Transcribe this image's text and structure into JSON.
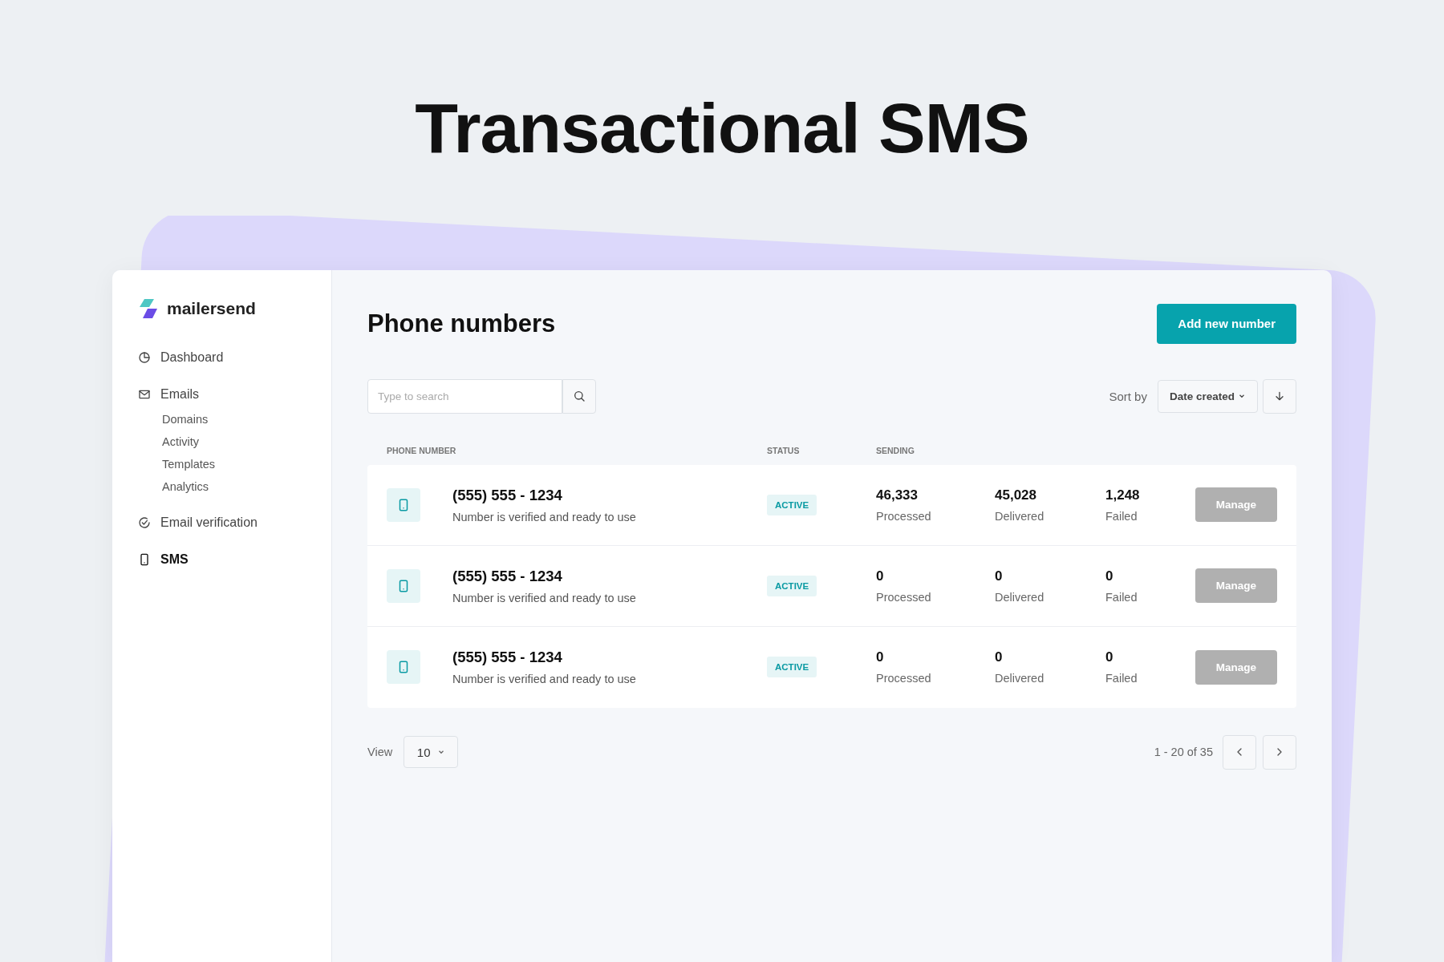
{
  "headline": "Transactional SMS",
  "brand": {
    "name": "mailersend"
  },
  "sidebar": {
    "items": [
      {
        "label": "Dashboard",
        "kind": "dashboard",
        "selected": false
      },
      {
        "label": "Emails",
        "kind": "emails",
        "selected": false,
        "children": [
          {
            "label": "Domains",
            "selected": false
          },
          {
            "label": "Activity",
            "selected": false
          },
          {
            "label": "Templates",
            "selected": false
          },
          {
            "label": "Analytics",
            "selected": false
          }
        ]
      },
      {
        "label": "Email verification",
        "kind": "verification",
        "selected": false
      },
      {
        "label": "SMS",
        "kind": "sms",
        "selected": true
      }
    ]
  },
  "page": {
    "title": "Phone numbers",
    "primary_button": "Add new number"
  },
  "search": {
    "placeholder": "Type to search"
  },
  "sort": {
    "label": "Sort by",
    "value": "Date created"
  },
  "table": {
    "columns": [
      "PHONE NUMBER",
      "STATUS",
      "SENDING"
    ],
    "rows": [
      {
        "number": "(555) 555 - 1234",
        "note": "Number is verified and ready to use",
        "status": "ACTIVE",
        "stats": [
          {
            "value": "46,333",
            "label": "Processed"
          },
          {
            "value": "45,028",
            "label": "Delivered"
          },
          {
            "value": "1,248",
            "label": "Failed"
          }
        ],
        "action": "Manage",
        "disabled": true
      },
      {
        "number": "(555) 555 - 1234",
        "note": "Number is verified and ready to use",
        "status": "ACTIVE",
        "stats": [
          {
            "value": "0",
            "label": "Processed"
          },
          {
            "value": "0",
            "label": "Delivered"
          },
          {
            "value": "0",
            "label": "Failed"
          }
        ],
        "action": "Manage",
        "disabled": true
      },
      {
        "number": "(555) 555 - 1234",
        "note": "Number is verified and ready to use",
        "status": "ACTIVE",
        "stats": [
          {
            "value": "0",
            "label": "Processed"
          },
          {
            "value": "0",
            "label": "Delivered"
          },
          {
            "value": "0",
            "label": "Failed"
          }
        ],
        "action": "Manage",
        "disabled": true
      }
    ]
  },
  "pagination": {
    "view_label": "View",
    "per_page": "10",
    "range": "1 - 20 of 35"
  }
}
